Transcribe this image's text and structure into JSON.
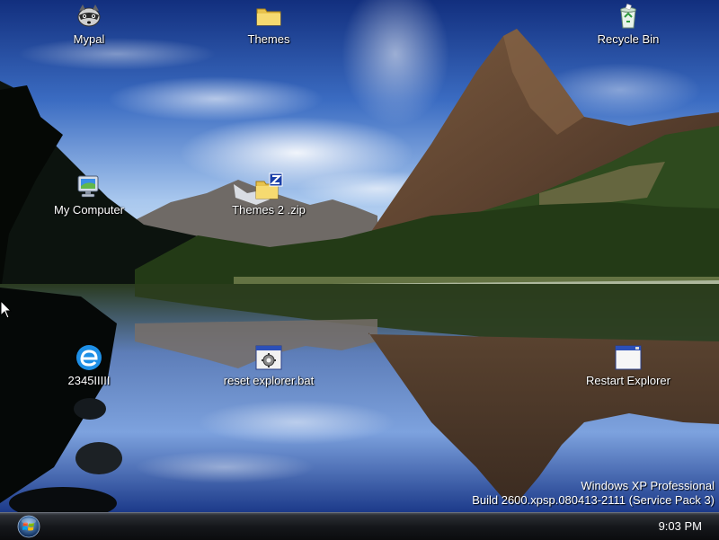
{
  "desktop": {
    "icons": [
      {
        "label": "Mypal",
        "icon": "raccoon-icon"
      },
      {
        "label": "Themes",
        "icon": "folder-icon"
      },
      {
        "label": "Recycle Bin",
        "icon": "recycle-bin-icon"
      },
      {
        "label": "My Computer",
        "icon": "my-computer-icon"
      },
      {
        "label": "Themes 2 .zip",
        "icon": "zip-folder-icon"
      },
      {
        "label": "2345IIIII",
        "icon": "ie-browser-icon"
      },
      {
        "label": "reset explorer.bat",
        "icon": "batch-file-icon"
      },
      {
        "label": "Restart Explorer",
        "icon": "application-window-icon"
      }
    ],
    "watermark": {
      "line1": "Windows XP Professional",
      "line2": "Build 2600.xpsp.080413-2111 (Service Pack 3)"
    }
  },
  "taskbar": {
    "start_icon": "windows-orb-icon",
    "clock": "9:03 PM"
  },
  "colors": {
    "sky_top": "#1b3a8c",
    "sky_light": "#9fc2ea",
    "taskbar": "#15171b",
    "text": "#ffffff"
  }
}
